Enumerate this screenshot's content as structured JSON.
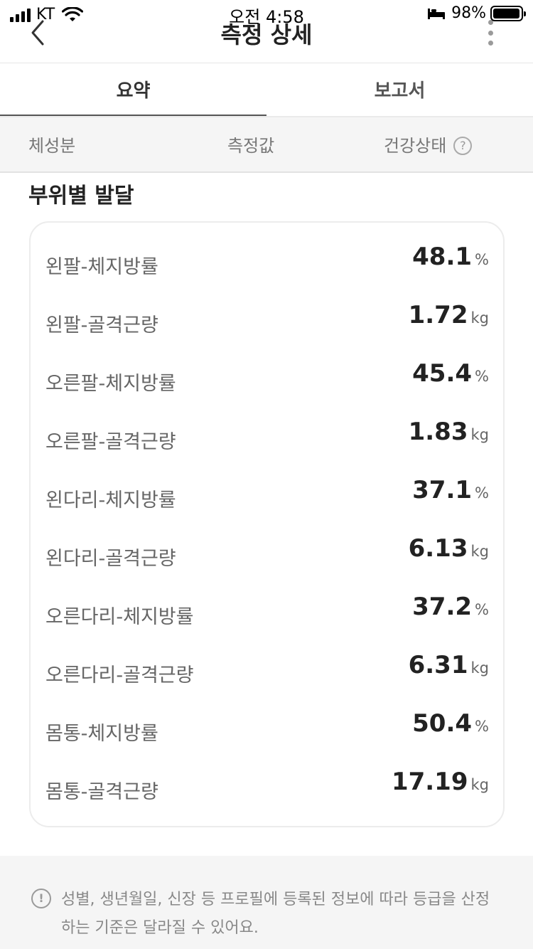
{
  "status_bar": {
    "carrier": "KT",
    "time": "오전 4:58",
    "battery": "98%"
  },
  "nav": {
    "title": "측정 상세"
  },
  "tabs": [
    {
      "label": "요약",
      "active": true
    },
    {
      "label": "보고서",
      "active": false
    }
  ],
  "subtabs": [
    {
      "label": "체성분"
    },
    {
      "label": "측정값"
    },
    {
      "label": "건강상태"
    }
  ],
  "section": {
    "title": "부위별 발달",
    "rows": [
      {
        "label": "왼팔-체지방률",
        "value": "48.1",
        "unit": "%"
      },
      {
        "label": "왼팔-골격근량",
        "value": "1.72",
        "unit": "kg"
      },
      {
        "label": "오른팔-체지방률",
        "value": "45.4",
        "unit": "%"
      },
      {
        "label": "오른팔-골격근량",
        "value": "1.83",
        "unit": "kg"
      },
      {
        "label": "왼다리-체지방률",
        "value": "37.1",
        "unit": "%"
      },
      {
        "label": "왼다리-골격근량",
        "value": "6.13",
        "unit": "kg"
      },
      {
        "label": "오른다리-체지방률",
        "value": "37.2",
        "unit": "%"
      },
      {
        "label": "오른다리-골격근량",
        "value": "6.31",
        "unit": "kg"
      },
      {
        "label": "몸통-체지방률",
        "value": "50.4",
        "unit": "%"
      },
      {
        "label": "몸통-골격근량",
        "value": "17.19",
        "unit": "kg"
      }
    ]
  },
  "footer": {
    "note": "성별, 생년월일, 신장 등 프로필에 등록된 정보에 따라 등급을 산정하는 기준은 달라질 수 있어요."
  },
  "icons": {
    "help": "?",
    "info": "!"
  }
}
